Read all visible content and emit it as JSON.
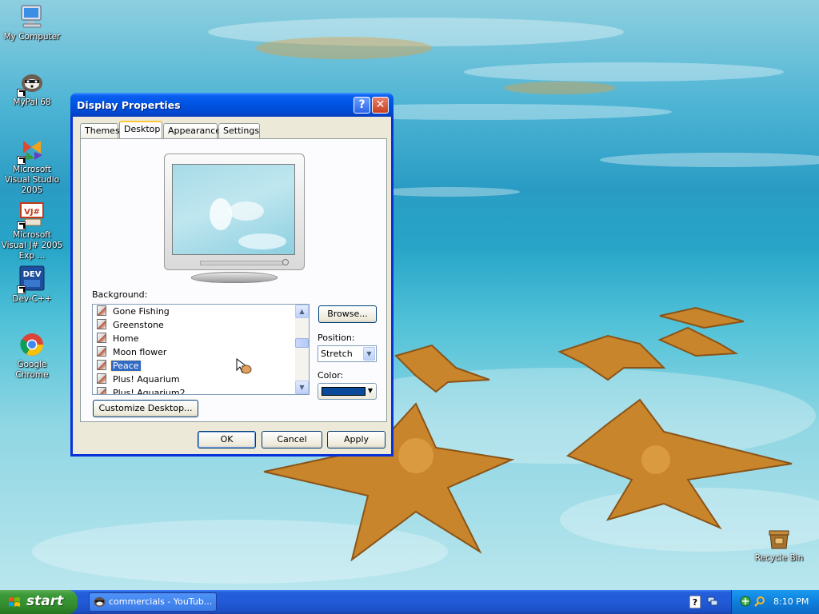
{
  "desktop": {
    "icons": [
      {
        "label": "My Computer"
      },
      {
        "label": "MyPal 68"
      },
      {
        "label": "Microsoft Visual Studio 2005"
      },
      {
        "label": "Microsoft Visual J# 2005 Exp ..."
      },
      {
        "label": "Dev-C++"
      },
      {
        "label": "Google Chrome"
      },
      {
        "label": "Recycle Bin"
      }
    ]
  },
  "dialog": {
    "title": "Display Properties",
    "help_glyph": "?",
    "close_glyph": "✕",
    "tabs": [
      {
        "label": "Themes"
      },
      {
        "label": "Desktop"
      },
      {
        "label": "Appearance"
      },
      {
        "label": "Settings"
      }
    ],
    "active_tab": "Desktop",
    "background_label": "Background:",
    "backgrounds": [
      {
        "label": "Gone Fishing"
      },
      {
        "label": "Greenstone"
      },
      {
        "label": "Home"
      },
      {
        "label": "Moon flower"
      },
      {
        "label": "Peace"
      },
      {
        "label": "Plus! Aquarium"
      },
      {
        "label": "Plus! Aquarium2"
      }
    ],
    "selected_background": "Peace",
    "browse_label": "Browse...",
    "position_label": "Position:",
    "position_value": "Stretch",
    "color_label": "Color:",
    "color_value": "#0b4a9a",
    "customize_label": "Customize Desktop...",
    "ok_label": "OK",
    "cancel_label": "Cancel",
    "apply_label": "Apply"
  },
  "taskbar": {
    "start_label": "start",
    "tasks": [
      {
        "label": "commercials - YouTub..."
      }
    ],
    "clock": "8:10 PM"
  },
  "colors": {
    "titlebar": "#0054e3",
    "taskbar": "#245edb",
    "start": "#3c9a39",
    "selection": "#316ac5",
    "dialog_face": "#ece9d8"
  },
  "icons": [
    "computer-icon",
    "browser-icon",
    "visual-studio-icon",
    "vjsharp-icon",
    "devcpp-icon",
    "chrome-icon",
    "recycle-bin-icon",
    "help-icon",
    "close-icon",
    "windows-logo-icon"
  ]
}
